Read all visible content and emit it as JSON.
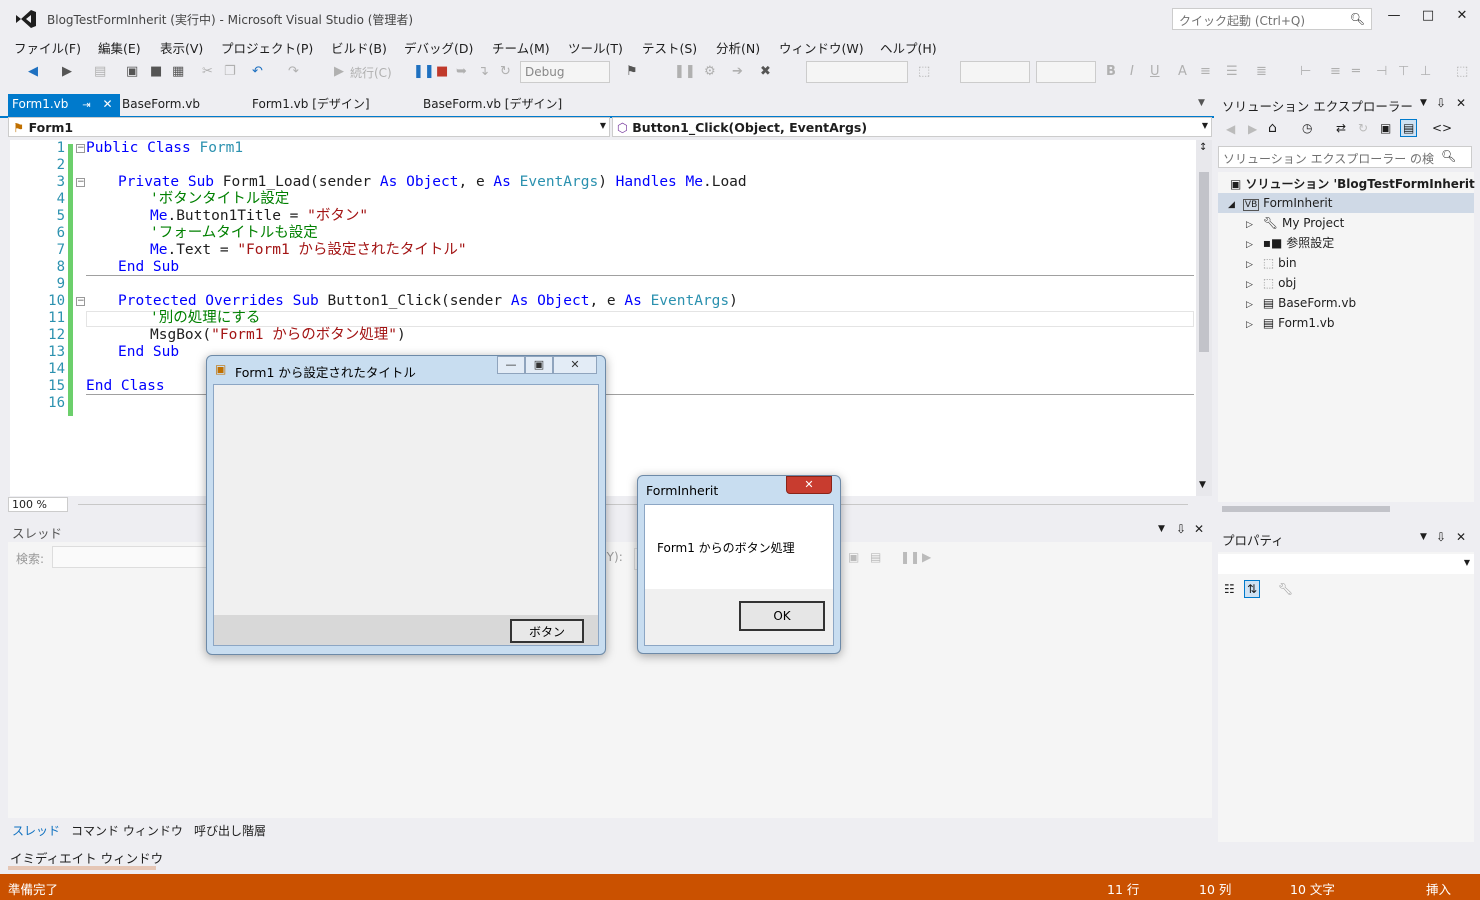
{
  "window": {
    "title": "BlogTestFormInherit (実行中) - Microsoft Visual Studio (管理者)",
    "quick_launch_placeholder": "クイック起動 (Ctrl+Q)"
  },
  "menu": [
    "ファイル(F)",
    "編集(E)",
    "表示(V)",
    "プロジェクト(P)",
    "ビルド(B)",
    "デバッグ(D)",
    "チーム(M)",
    "ツール(T)",
    "テスト(S)",
    "分析(N)",
    "ウィンドウ(W)",
    "ヘルプ(H)"
  ],
  "toolbar": {
    "continue_label": "続行(C)",
    "config": "Debug"
  },
  "doc_tabs": [
    {
      "label": "Form1.vb",
      "active": true
    },
    {
      "label": "BaseForm.vb",
      "active": false
    },
    {
      "label": "Form1.vb [デザイン]",
      "active": false
    },
    {
      "label": "BaseForm.vb [デザイン]",
      "active": false
    }
  ],
  "nav": {
    "class_combo": "Form1",
    "member_combo": "Button1_Click(Object, EventArgs)"
  },
  "editor": {
    "line_numbers": [
      "1",
      "2",
      "3",
      "4",
      "5",
      "6",
      "7",
      "8",
      "9",
      "10",
      "11",
      "12",
      "13",
      "14",
      "15",
      "16"
    ],
    "zoom": "100 %",
    "code": {
      "l1_kw": "Public Class",
      "l1_ty": " Form1",
      "l3_kw1": "Private Sub",
      "l3_a": " Form1_Load(sender ",
      "l3_kw2": "As",
      "l3_b": " ",
      "l3_kw3": "Object",
      "l3_c": ", e ",
      "l3_kw4": "As",
      "l3_d": " ",
      "l3_ty": "EventArgs",
      "l3_e": ") ",
      "l3_kw5": "Handles",
      "l3_f": " ",
      "l3_kw6": "Me",
      "l3_g": ".Load",
      "l4_cm": "'ボタンタイトル設定",
      "l5_kw": "Me",
      "l5_a": ".Button1Title = ",
      "l5_st": "\"ボタン\"",
      "l6_cm": "'フォームタイトルも設定",
      "l7_kw": "Me",
      "l7_a": ".Text = ",
      "l7_st": "\"Form1 から設定されたタイトル\"",
      "l8_kw": "End Sub",
      "l10_kw1": "Protected Overrides Sub",
      "l10_a": " Button1_Click(sender ",
      "l10_kw2": "As",
      "l10_b": " ",
      "l10_kw3": "Object",
      "l10_c": ", e ",
      "l10_kw4": "As",
      "l10_d": " ",
      "l10_ty": "EventArgs",
      "l10_e": ")",
      "l11_cm": "'別の処理にする",
      "l12_a": "MsgBox(",
      "l12_st": "\"Form1 からのボタン処理\"",
      "l12_b": ")",
      "l13_kw": "End Sub",
      "l15_kw": "End Class"
    }
  },
  "threads_panel": {
    "title": "スレッド",
    "search_label": "検索:",
    "partial_label": "(Y):"
  },
  "bottom_tabs": [
    "スレッド",
    "コマンド ウィンドウ",
    "呼び出し階層"
  ],
  "immediate_title": "イミディエイト ウィンドウ",
  "solution_explorer": {
    "title": "ソリューション エクスプローラー",
    "search_placeholder": "ソリューション エクスプローラー の検",
    "nodes": [
      {
        "label": "ソリューション 'BlogTestFormInherit",
        "icon": "solution-icon"
      },
      {
        "label": "FormInherit",
        "icon": "vb-project-icon"
      },
      {
        "label": "My Project",
        "icon": "wrench-icon"
      },
      {
        "label": "参照設定",
        "icon": "references-icon"
      },
      {
        "label": "bin",
        "icon": "folder-icon"
      },
      {
        "label": "obj",
        "icon": "folder-icon"
      },
      {
        "label": "BaseForm.vb",
        "icon": "form-icon"
      },
      {
        "label": "Form1.vb",
        "icon": "form-icon"
      }
    ]
  },
  "properties": {
    "title": "プロパティ"
  },
  "form1_window": {
    "title": "Form1 から設定されたタイトル",
    "button_label": "ボタン"
  },
  "msgbox": {
    "title": "FormInherit",
    "message": "Form1 からのボタン処理",
    "ok_label": "OK"
  },
  "status": {
    "ready": "準備完了",
    "line": "11 行",
    "col": "10 列",
    "ch": "10 文字",
    "mode": "挿入"
  },
  "colors": {
    "accent": "#007acc",
    "status_bar": "#ca5100",
    "change_bar": "#6ccf6c"
  }
}
